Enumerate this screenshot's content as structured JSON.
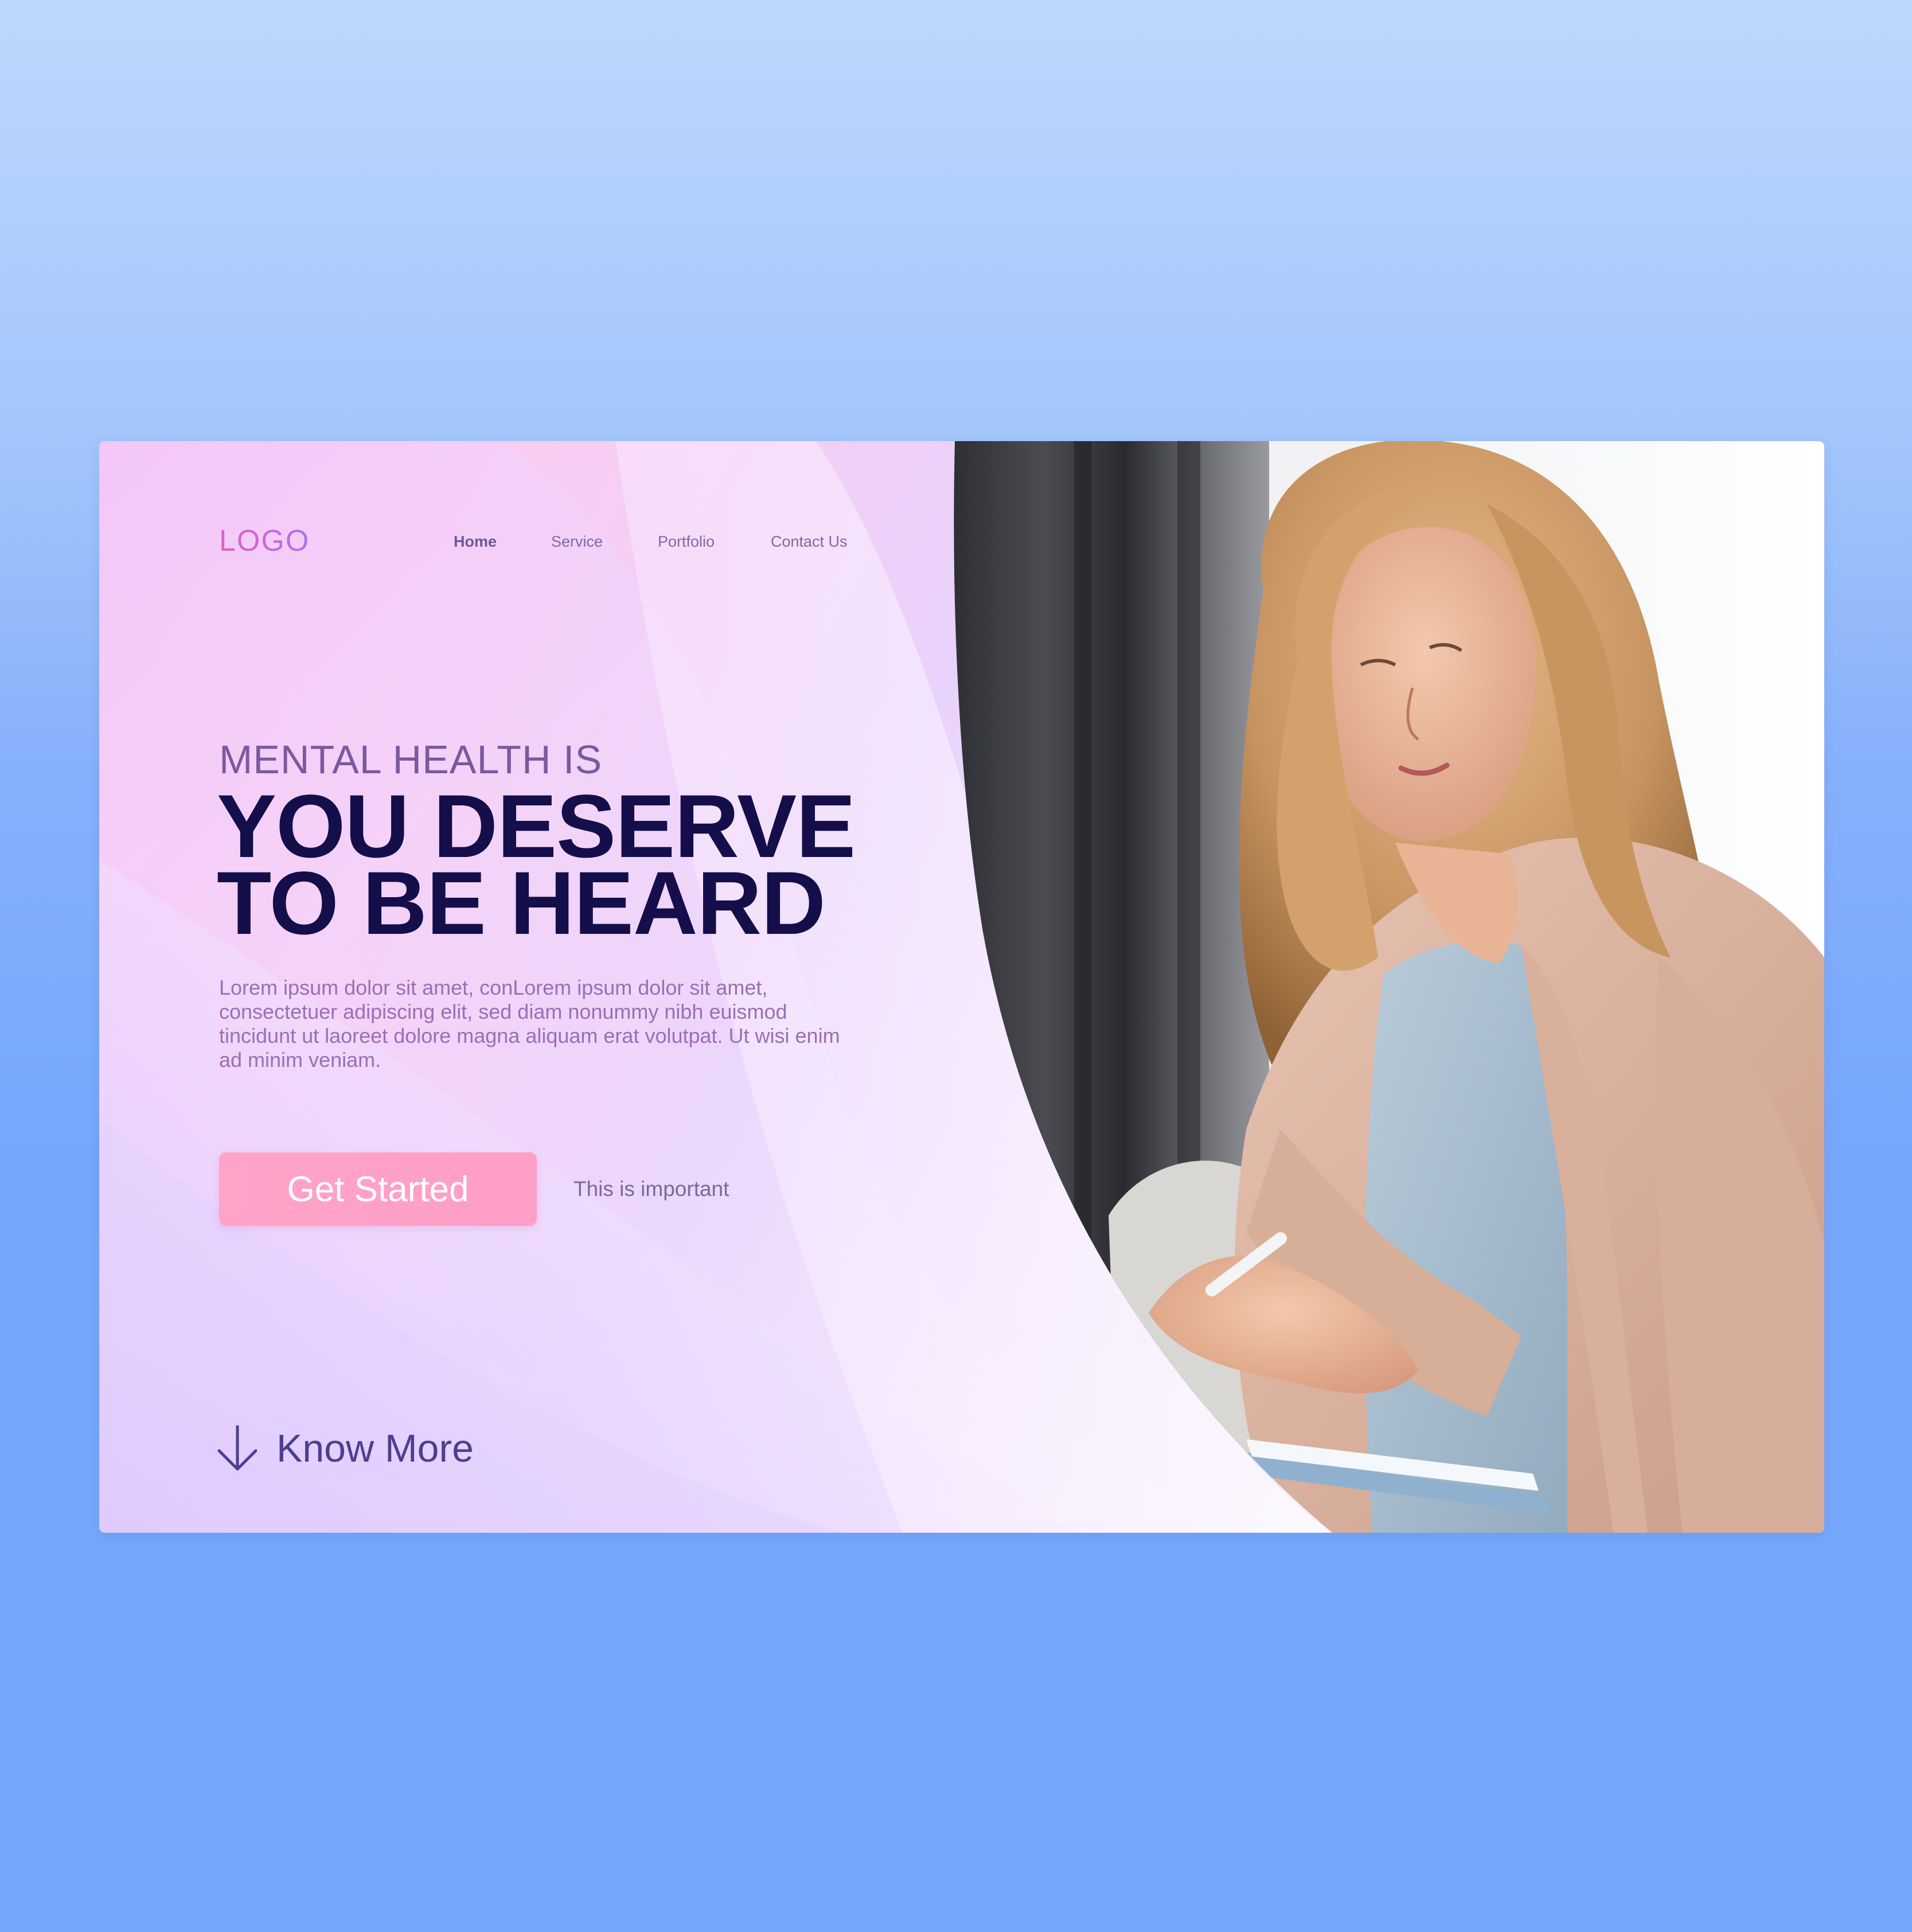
{
  "logo": "LOGO",
  "nav": {
    "items": [
      {
        "label": "Home",
        "active": true
      },
      {
        "label": "Service",
        "active": false
      },
      {
        "label": "Portfolio",
        "active": false
      },
      {
        "label": "Contact Us",
        "active": false
      }
    ]
  },
  "hero": {
    "eyebrow": "MENTAL HEALTH IS",
    "headline_line1": "YOU DESERVE",
    "headline_line2": "TO BE HEARD",
    "body": "Lorem ipsum dolor sit amet, conLorem ipsum dolor sit amet, consectetuer adipiscing elit, sed diam nonummy nibh euismod tincidunt ut laoreet dolore magna aliquam erat volutpat. Ut wisi enim ad minim veniam.",
    "cta_label": "Get Started",
    "cta_note": "This is important",
    "know_more": "Know More"
  },
  "icons": {
    "know_more": "arrow-down-icon"
  },
  "colors": {
    "page_background": "#76a7fb",
    "logo": "#d860d8",
    "headline": "#140e4a",
    "eyebrow": "#7a5a9e",
    "body_text": "#9a6fb3",
    "cta_background": "#ffa3c9",
    "know_more": "#4d3f8f"
  }
}
